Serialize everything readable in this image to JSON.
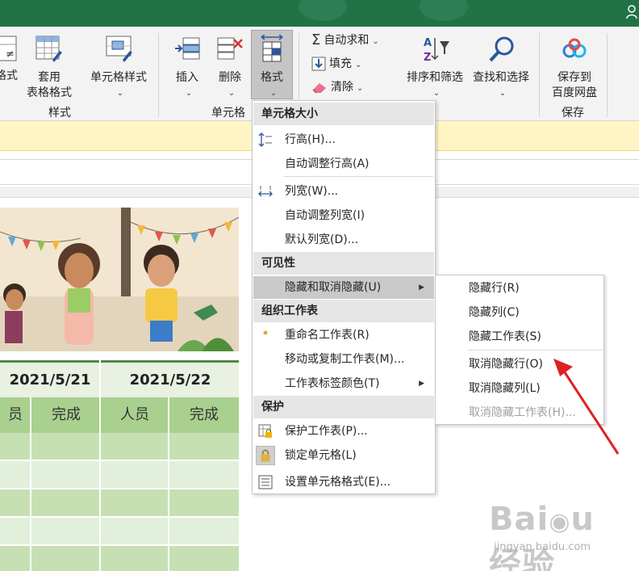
{
  "ribbon": {
    "partial_format_label": "格式",
    "apply_table_format_line1": "套用",
    "apply_table_format_line2": "表格格式",
    "cell_styles_label": "单元格样式",
    "styles_group_label": "样式",
    "insert_label": "插入",
    "delete_label": "删除",
    "format_label": "格式",
    "cells_group_label": "单元格",
    "autosum_label": "自动求和",
    "fill_label": "填充",
    "clear_label": "清除",
    "sort_filter_label": "排序和筛选",
    "find_select_label": "查找和选择",
    "save_baidu_line1": "保存到",
    "save_baidu_line2": "百度网盘",
    "save_group_label": "保存",
    "dropdown_caret": "⌄"
  },
  "sheet": {
    "dates": [
      "2021/5/21",
      "2021/5/22"
    ],
    "headers": [
      "员",
      "完成",
      "人员",
      "完成"
    ]
  },
  "format_menu": {
    "cell_size_header": "单元格大小",
    "row_height": "行高(H)...",
    "autofit_row_height": "自动调整行高(A)",
    "column_width": "列宽(W)...",
    "autofit_column_width": "自动调整列宽(I)",
    "default_width": "默认列宽(D)...",
    "visibility_header": "可见性",
    "hide_unhide": "隐藏和取消隐藏(U)",
    "organize_sheets_header": "组织工作表",
    "rename_sheet": "重命名工作表(R)",
    "move_copy_sheet": "移动或复制工作表(M)...",
    "tab_color": "工作表标签颜色(T)",
    "protection_header": "保护",
    "protect_sheet": "保护工作表(P)...",
    "lock_cell": "锁定单元格(L)",
    "format_cells": "设置单元格格式(E)..."
  },
  "hide_submenu": {
    "hide_rows": "隐藏行(R)",
    "hide_columns": "隐藏列(C)",
    "hide_sheet": "隐藏工作表(S)",
    "unhide_rows": "取消隐藏行(O)",
    "unhide_columns": "取消隐藏列(L)",
    "unhide_sheet": "取消隐藏工作表(H)..."
  },
  "colors": {
    "title_bar": "#217346",
    "header_green": "#a9d08e",
    "annotation_red": "#e02020"
  },
  "watermark": {
    "url": "jingyan.baidu.com"
  }
}
